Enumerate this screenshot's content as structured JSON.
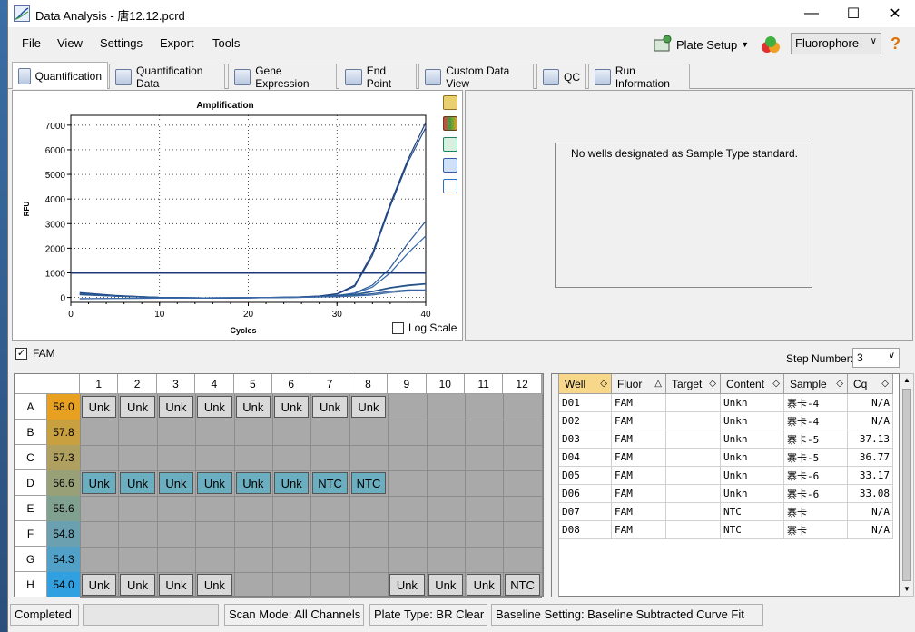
{
  "window": {
    "title": "Data Analysis - 唐12.12.pcrd"
  },
  "menu": [
    "File",
    "View",
    "Settings",
    "Export",
    "Tools"
  ],
  "toolbar": {
    "plate_setup": "Plate Setup",
    "fluorophore": "Fluorophore"
  },
  "tabs": [
    {
      "label": "Quantification",
      "active": true
    },
    {
      "label": "Quantification Data"
    },
    {
      "label": "Gene Expression"
    },
    {
      "label": "End Point"
    },
    {
      "label": "Custom Data View"
    },
    {
      "label": "QC"
    },
    {
      "label": "Run Information"
    }
  ],
  "chart_data": {
    "type": "line",
    "title": "Amplification",
    "xlabel": "Cycles",
    "ylabel": "RFU",
    "xlim": [
      0,
      40
    ],
    "ylim": [
      -200,
      7400
    ],
    "xticks": [
      0,
      10,
      20,
      30,
      40
    ],
    "yticks": [
      0,
      1000,
      2000,
      3000,
      4000,
      5000,
      6000,
      7000
    ],
    "threshold": 1000,
    "grid": true,
    "series": [
      {
        "x": [
          1,
          5,
          10,
          15,
          20,
          25,
          28,
          30,
          32,
          34,
          36,
          38,
          40
        ],
        "y": [
          200,
          80,
          0,
          -30,
          -20,
          10,
          60,
          150,
          500,
          1800,
          3800,
          5600,
          7100
        ]
      },
      {
        "x": [
          1,
          5,
          10,
          15,
          20,
          25,
          28,
          30,
          32,
          34,
          36,
          38,
          40
        ],
        "y": [
          180,
          70,
          0,
          -30,
          -20,
          10,
          50,
          130,
          450,
          1700,
          3700,
          5500,
          6900
        ]
      },
      {
        "x": [
          1,
          5,
          10,
          15,
          20,
          25,
          28,
          30,
          32,
          34,
          36,
          38,
          40
        ],
        "y": [
          150,
          60,
          0,
          -20,
          -10,
          10,
          30,
          80,
          180,
          500,
          1200,
          2200,
          3100
        ]
      },
      {
        "x": [
          1,
          5,
          10,
          15,
          20,
          25,
          28,
          30,
          32,
          34,
          36,
          38,
          40
        ],
        "y": [
          140,
          60,
          0,
          -20,
          -10,
          10,
          30,
          70,
          160,
          420,
          1000,
          1800,
          2500
        ]
      },
      {
        "x": [
          1,
          5,
          10,
          15,
          20,
          25,
          28,
          30,
          32,
          34,
          36,
          38,
          40
        ],
        "y": [
          120,
          50,
          0,
          -20,
          -10,
          10,
          30,
          60,
          120,
          250,
          400,
          500,
          560
        ]
      },
      {
        "x": [
          1,
          5,
          10,
          15,
          20,
          25,
          28,
          30,
          32,
          34,
          36,
          38,
          40
        ],
        "y": [
          110,
          50,
          0,
          -20,
          -10,
          10,
          30,
          60,
          110,
          230,
          380,
          480,
          540
        ]
      },
      {
        "x": [
          1,
          5,
          10,
          15,
          20,
          25,
          28,
          30,
          32,
          34,
          36,
          38,
          40
        ],
        "y": [
          -50,
          -40,
          -30,
          -20,
          -10,
          0,
          20,
          40,
          80,
          150,
          250,
          300,
          300
        ]
      },
      {
        "x": [
          1,
          5,
          10,
          15,
          20,
          25,
          28,
          30,
          32,
          34,
          36,
          38,
          40
        ],
        "y": [
          -60,
          -40,
          -30,
          -20,
          -10,
          0,
          20,
          30,
          60,
          100,
          200,
          260,
          280
        ]
      }
    ]
  },
  "log_scale_label": "Log Scale",
  "std_curve_message": "No wells designated as Sample Type standard.",
  "fam_label": "FAM",
  "step_label": "Step Number:",
  "step_value": "3",
  "plate": {
    "columns": [
      "1",
      "2",
      "3",
      "4",
      "5",
      "6",
      "7",
      "8",
      "9",
      "10",
      "11",
      "12"
    ],
    "rows": [
      "A",
      "B",
      "C",
      "D",
      "E",
      "F",
      "G",
      "H"
    ],
    "temps": [
      "58.0",
      "57.8",
      "57.3",
      "56.6",
      "55.6",
      "54.8",
      "54.3",
      "54.0"
    ],
    "temp_colors": [
      "#e8a020",
      "#c8a040",
      "#b0a060",
      "#98a078",
      "#80a090",
      "#6aa0b0",
      "#50a0c8",
      "#30a0e0"
    ],
    "wells": {
      "A": [
        "Unk",
        "Unk",
        "Unk",
        "Unk",
        "Unk",
        "Unk",
        "Unk",
        "Unk",
        "",
        "",
        "",
        ""
      ],
      "B": [
        "",
        "",
        "",
        "",
        "",
        "",
        "",
        "",
        "",
        "",
        "",
        ""
      ],
      "C": [
        "",
        "",
        "",
        "",
        "",
        "",
        "",
        "",
        "",
        "",
        "",
        ""
      ],
      "D": [
        "Unk",
        "Unk",
        "Unk",
        "Unk",
        "Unk",
        "Unk",
        "NTC",
        "NTC",
        "",
        "",
        "",
        ""
      ],
      "E": [
        "",
        "",
        "",
        "",
        "",
        "",
        "",
        "",
        "",
        "",
        "",
        ""
      ],
      "F": [
        "",
        "",
        "",
        "",
        "",
        "",
        "",
        "",
        "",
        "",
        "",
        ""
      ],
      "G": [
        "",
        "",
        "",
        "",
        "",
        "",
        "",
        "",
        "",
        "",
        "",
        ""
      ],
      "H": [
        "Unk",
        "Unk",
        "Unk",
        "Unk",
        "",
        "",
        "",
        "",
        "Unk",
        "Unk",
        "Unk",
        "NTC"
      ]
    }
  },
  "table": {
    "headers": [
      "Well",
      "Fluor",
      "Target",
      "Content",
      "Sample",
      "Cq"
    ],
    "rows": [
      [
        "D01",
        "FAM",
        "",
        "Unkn",
        "寨卡-4",
        "N/A"
      ],
      [
        "D02",
        "FAM",
        "",
        "Unkn",
        "寨卡-4",
        "N/A"
      ],
      [
        "D03",
        "FAM",
        "",
        "Unkn",
        "寨卡-5",
        "37.13"
      ],
      [
        "D04",
        "FAM",
        "",
        "Unkn",
        "寨卡-5",
        "36.77"
      ],
      [
        "D05",
        "FAM",
        "",
        "Unkn",
        "寨卡-6",
        "33.17"
      ],
      [
        "D06",
        "FAM",
        "",
        "Unkn",
        "寨卡-6",
        "33.08"
      ],
      [
        "D07",
        "FAM",
        "",
        "NTC",
        "寨卡",
        "N/A"
      ],
      [
        "D08",
        "FAM",
        "",
        "NTC",
        "寨卡",
        "N/A"
      ]
    ]
  },
  "status": {
    "state": "Completed",
    "scan_mode": "Scan Mode: All Channels",
    "plate_type": "Plate Type: BR Clear",
    "baseline": "Baseline Setting: Baseline Subtracted Curve Fit"
  }
}
